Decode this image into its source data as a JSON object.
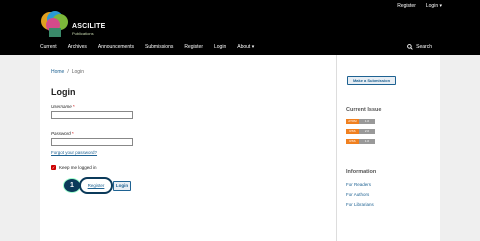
{
  "header": {
    "user_nav": {
      "register": "Register",
      "login": "Login ▾"
    },
    "logo": {
      "name": "ASCILITE",
      "sub": "Publications"
    },
    "nav": [
      "Current",
      "Archives",
      "Announcements",
      "Submissions",
      "Register",
      "Login",
      "About ▾"
    ],
    "search": "Search"
  },
  "breadcrumb": {
    "home": "Home",
    "sep": "/",
    "current": "Login"
  },
  "form": {
    "title": "Login",
    "username_label": "Username",
    "password_label": "Password",
    "required_mark": "*",
    "forgot": "Forgot your password?",
    "keep": "Keep me logged in",
    "register": "Register",
    "login": "Login",
    "step": "1"
  },
  "sidebar": {
    "make_submission": "Make a Submission",
    "current_issue": "Current Issue",
    "badges": [
      {
        "left": "ATOM",
        "right": "1.0"
      },
      {
        "left": "RSS",
        "right": "2.0"
      },
      {
        "left": "RSS",
        "right": "1.0"
      }
    ],
    "information": "Information",
    "links": [
      "For Readers",
      "For Authors",
      "For Librarians"
    ]
  }
}
